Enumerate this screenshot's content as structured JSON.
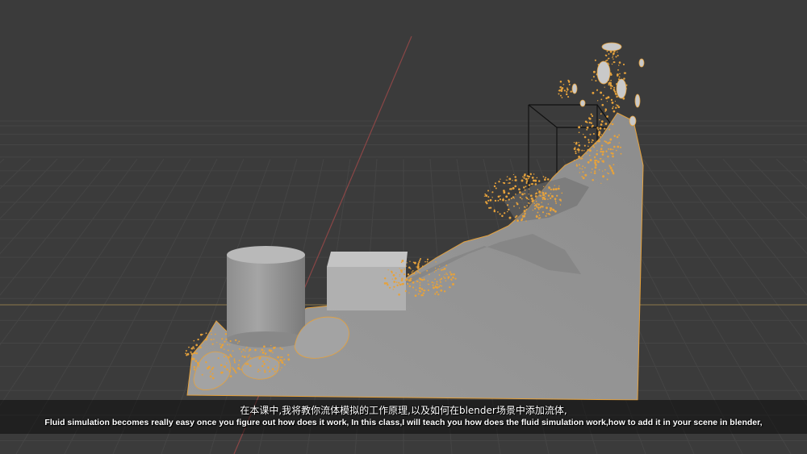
{
  "viewport": {
    "background": "#3b3b3b",
    "grid_color": "#454545",
    "x_axis_color": "#7d6d48",
    "y_axis_color": "#8a4646",
    "fluid_particle_color": "#e6a23c",
    "mesh_color": "#9a9a9a"
  },
  "subtitles": {
    "chinese": "在本课中,我将教你流体模拟的工作原理,以及如何在blender场景中添加流体,",
    "english": "Fluid simulation becomes really easy once you figure out how does it work, In this class,I will teach you how does the fluid simulation work,how to add it in your scene in blender,"
  }
}
